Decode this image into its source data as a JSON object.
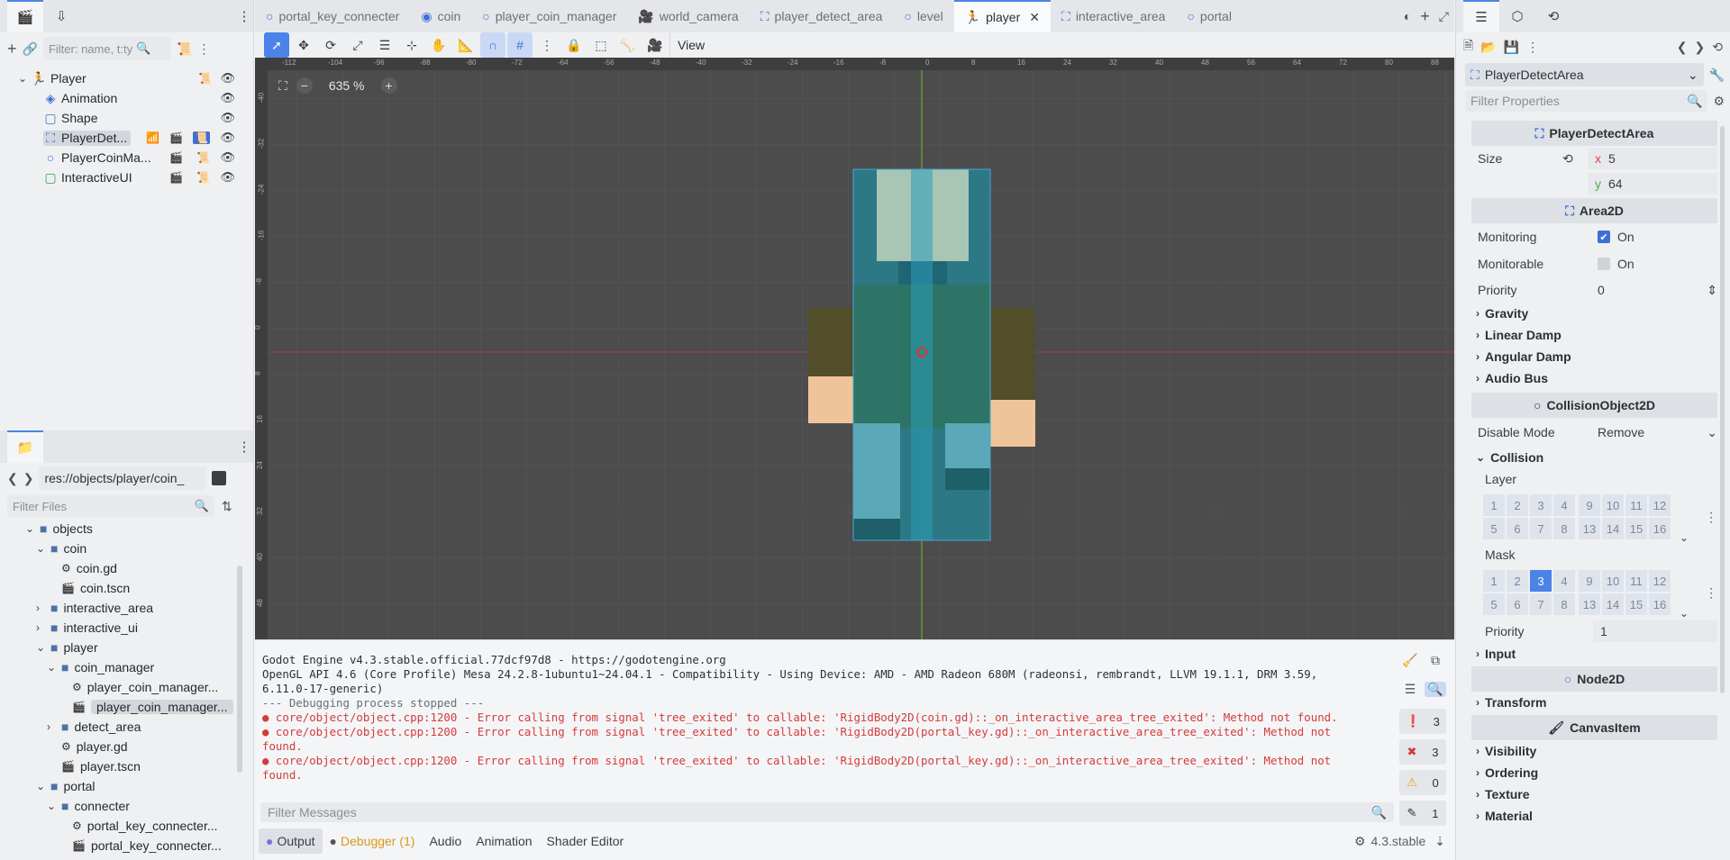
{
  "scene_dock": {
    "filter_placeholder": "Filter: name, t:ty",
    "nodes": [
      {
        "label": "Player",
        "icon": "person-node-icon"
      },
      {
        "label": "Animation",
        "icon": "animated-sprite-icon"
      },
      {
        "label": "Shape",
        "icon": "collision-shape-icon"
      },
      {
        "label": "PlayerDet...",
        "icon": "area2d-icon"
      },
      {
        "label": "PlayerCoinMa...",
        "icon": "node2d-icon"
      },
      {
        "label": "InteractiveUI",
        "icon": "control-icon"
      }
    ]
  },
  "filesystem": {
    "path": "res://objects/player/coin_",
    "filter_placeholder": "Filter Files",
    "items": [
      {
        "label": "objects",
        "type": "folder",
        "depth": 1,
        "open": true
      },
      {
        "label": "coin",
        "type": "folder",
        "depth": 2,
        "open": true
      },
      {
        "label": "coin.gd",
        "type": "script",
        "depth": 3
      },
      {
        "label": "coin.tscn",
        "type": "scene",
        "depth": 3
      },
      {
        "label": "interactive_area",
        "type": "folder",
        "depth": 2,
        "open": false
      },
      {
        "label": "interactive_ui",
        "type": "folder",
        "depth": 2,
        "open": false
      },
      {
        "label": "player",
        "type": "folder",
        "depth": 2,
        "open": true
      },
      {
        "label": "coin_manager",
        "type": "folder",
        "depth": 3,
        "open": true
      },
      {
        "label": "player_coin_manager...",
        "type": "script",
        "depth": 4
      },
      {
        "label": "player_coin_manager...",
        "type": "scene",
        "depth": 4,
        "selected": true
      },
      {
        "label": "detect_area",
        "type": "folder",
        "depth": 3,
        "open": false
      },
      {
        "label": "player.gd",
        "type": "script",
        "depth": 3
      },
      {
        "label": "player.tscn",
        "type": "scene",
        "depth": 3
      },
      {
        "label": "portal",
        "type": "folder",
        "depth": 2,
        "open": true
      },
      {
        "label": "connecter",
        "type": "folder",
        "depth": 3,
        "open": true
      },
      {
        "label": "portal_key_connecter...",
        "type": "script",
        "depth": 4
      },
      {
        "label": "portal_key_connecter...",
        "type": "scene",
        "depth": 4
      }
    ]
  },
  "scene_tabs": [
    {
      "label": "portal_key_connecter",
      "icon": "node2d-icon"
    },
    {
      "label": "coin",
      "icon": "rigidbody-icon"
    },
    {
      "label": "player_coin_manager",
      "icon": "node2d-icon"
    },
    {
      "label": "world_camera",
      "icon": "camera-icon"
    },
    {
      "label": "player_detect_area",
      "icon": "area2d-icon"
    },
    {
      "label": "level",
      "icon": "node2d-icon"
    },
    {
      "label": "player",
      "icon": "person-node-icon",
      "active": true
    },
    {
      "label": "interactive_area",
      "icon": "area2d-icon"
    },
    {
      "label": "portal",
      "icon": "node2d-icon"
    }
  ],
  "toolbar": {
    "view_label": "View"
  },
  "viewport": {
    "zoom": "635 %",
    "ruler_top": [
      "-112",
      "-104",
      "-96",
      "-88",
      "-80",
      "-72",
      "-64",
      "-56",
      "-48",
      "-40",
      "-32",
      "-24",
      "-16",
      "-8",
      "0",
      "8",
      "16",
      "24",
      "32",
      "40",
      "48",
      "56",
      "64",
      "72",
      "80",
      "88"
    ],
    "ruler_left": [
      "-40",
      "-32",
      "-24",
      "-16",
      "-8",
      "0",
      "8",
      "16",
      "24",
      "32",
      "40",
      "48"
    ]
  },
  "output": {
    "lines": [
      {
        "text": "Godot Engine v4.3.stable.official.77dcf97d8 - https://godotengine.org",
        "kind": "normal"
      },
      {
        "text": "OpenGL API 4.6 (Core Profile) Mesa 24.2.8-1ubuntu1~24.04.1 - Compatibility - Using Device: AMD - AMD Radeon 680M (radeonsi, rembrandt, LLVM 19.1.1, DRM 3.59,",
        "kind": "normal"
      },
      {
        "text": "6.11.0-17-generic)",
        "kind": "normal"
      },
      {
        "text": "",
        "kind": "normal"
      },
      {
        "text": "--- Debugging process stopped ---",
        "kind": "dim"
      },
      {
        "text": "● core/object/object.cpp:1200 - Error calling from signal 'tree_exited' to callable: 'RigidBody2D(coin.gd)::_on_interactive_area_tree_exited': Method not found.",
        "kind": "error"
      },
      {
        "text": "● core/object/object.cpp:1200 - Error calling from signal 'tree_exited' to callable: 'RigidBody2D(portal_key.gd)::_on_interactive_area_tree_exited': Method not",
        "kind": "error"
      },
      {
        "text": "found.",
        "kind": "error"
      },
      {
        "text": "● core/object/object.cpp:1200 - Error calling from signal 'tree_exited' to callable: 'RigidBody2D(portal_key.gd)::_on_interactive_area_tree_exited': Method not",
        "kind": "error"
      },
      {
        "text": "found.",
        "kind": "error"
      }
    ],
    "filter_placeholder": "Filter Messages",
    "counts": {
      "messages": "3",
      "errors": "3",
      "warnings": "0",
      "editor": "1"
    }
  },
  "bottom_tabs": {
    "output": "Output",
    "debugger": "Debugger (1)",
    "audio": "Audio",
    "animation": "Animation",
    "shader": "Shader Editor",
    "version": "4.3.stable"
  },
  "inspector": {
    "node_select": "PlayerDetectArea",
    "filter_placeholder": "Filter Properties",
    "section_main": "PlayerDetectArea",
    "size_label": "Size",
    "size_x": "5",
    "size_y": "64",
    "section_area": "Area2D",
    "monitoring_label": "Monitoring",
    "monitoring_value": "On",
    "monitorable_label": "Monitorable",
    "monitorable_value": "On",
    "priority_label": "Priority",
    "priority_value": "0",
    "groups_area": [
      "Gravity",
      "Linear Damp",
      "Angular Damp",
      "Audio Bus"
    ],
    "section_collision_object": "CollisionObject2D",
    "disable_mode_label": "Disable Mode",
    "disable_mode_value": "Remove",
    "collision_group": "Collision",
    "layer_label": "Layer",
    "mask_label": "Mask",
    "layer_bits": [
      "1",
      "2",
      "3",
      "4",
      "9",
      "10",
      "11",
      "12",
      "5",
      "6",
      "7",
      "8",
      "13",
      "14",
      "15",
      "16"
    ],
    "mask_active": "3",
    "collision_priority_label": "Priority",
    "collision_priority_value": "1",
    "input_group": "Input",
    "section_node2d": "Node2D",
    "transform_group": "Transform",
    "section_canvas": "CanvasItem",
    "groups_canvas": [
      "Visibility",
      "Ordering",
      "Texture",
      "Material"
    ]
  }
}
